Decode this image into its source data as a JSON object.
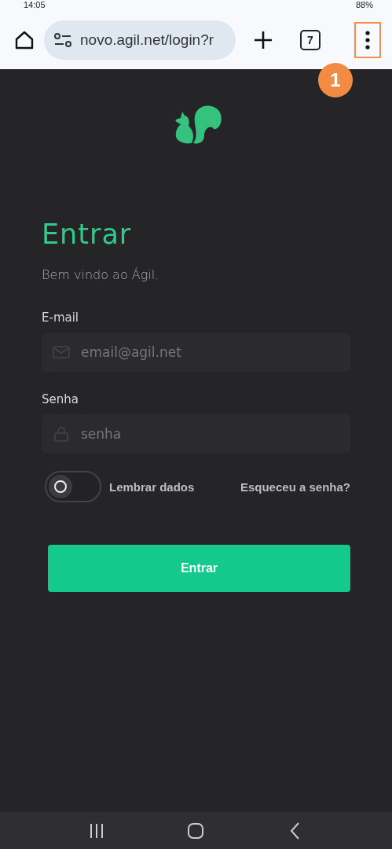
{
  "status_bar": {
    "time": "14:05",
    "battery": "88%"
  },
  "browser": {
    "url": "novo.agil.net/login?r",
    "tab_count": "7",
    "menu_highlighted": true,
    "annotation": "1"
  },
  "login": {
    "title": "Entrar",
    "subtitle": "Bem vindo ao Ágil.",
    "fields": [
      {
        "label": "E-mail",
        "placeholder": "email@agil.net",
        "kind": "email"
      },
      {
        "label": "Senha",
        "placeholder": "senha",
        "kind": "password"
      }
    ],
    "remember": {
      "label": "Lembrar dados",
      "on": false
    },
    "forgot_link": "Esqueceu a senha?",
    "submit": "Entrar"
  }
}
